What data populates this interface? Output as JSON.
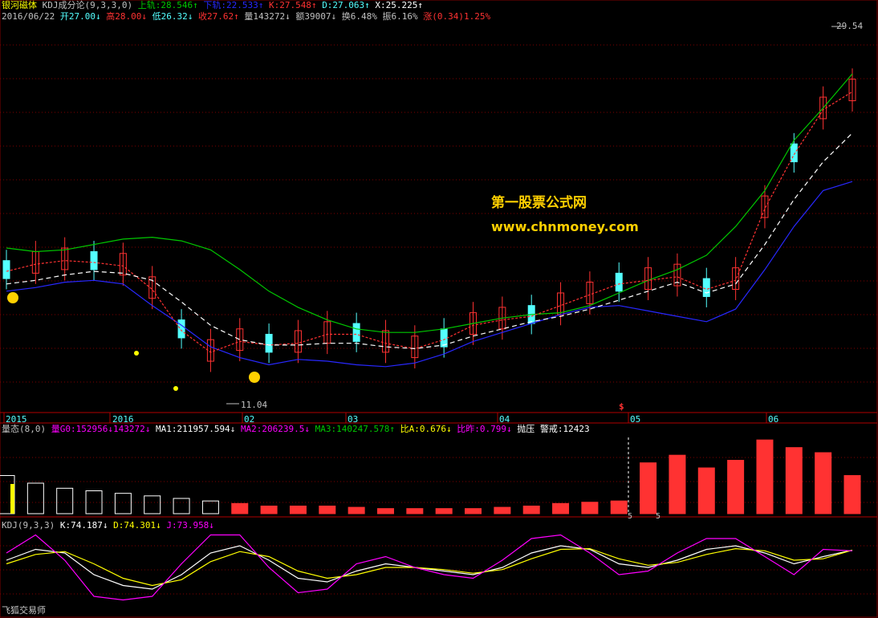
{
  "header1": {
    "indicator": "银河磁体",
    "indicator_params": "KDJ成分论(9,3,3,0)",
    "up_label": "上轨:28.546↑",
    "down_label": "下轨:22.533↑",
    "k_label": "K:27.548↑",
    "d_label": "D:27.063↑",
    "x_label": "X:25.225↑"
  },
  "header2": {
    "date": "2016/06/22",
    "open": "开27.00↓",
    "high": "高28.00↓",
    "low": "低26.32↓",
    "close": "收27.62↑",
    "volume": "量143272↓",
    "amount": "额39007↓",
    "turnover": "换6.48%",
    "amplitude": "振6.16%",
    "change": "涨(0.34)1.25%"
  },
  "vol_header": {
    "title": "量态(8,0)",
    "vol": "量G0:152956↓143272↓",
    "ma1": "MA1:211957.594↓",
    "ma2": "MA2:206239.5↓",
    "ma3": "MA3:140247.578↑",
    "ratio_a": "比A:0.676↓",
    "ratio_b": "比昨:0.799↓",
    "pressure": "抛压 警戒:12423"
  },
  "kdj_header": {
    "title": "KDJ(9,3,3)",
    "k": "K:74.187↓",
    "d": "D:74.301↓",
    "j": "J:73.958↓"
  },
  "x_axis_labels": [
    "2015",
    "2016",
    "02",
    "03",
    "04",
    "05",
    "06"
  ],
  "price_labels": {
    "high": "29.54",
    "low": "11.04"
  },
  "marker_dollar": "$",
  "volume_bottom_labels": [
    "5",
    "5"
  ],
  "watermark": {
    "line1": "第一股票公式网",
    "line2": "www.chnmoney.com"
  },
  "footer": "飞狐交易师",
  "colors": {
    "up": "#ff3232",
    "down": "#54ffff",
    "mid": "#00c800",
    "lower": "#2828ff",
    "ma": "#c832c8",
    "signal": "#ffffff",
    "yellow": "#ffff00",
    "magenta": "#ff00ff"
  },
  "chart_data": [
    {
      "type": "candlestick",
      "title": "",
      "x_ticks": [
        "2015",
        "2016",
        "02",
        "03",
        "04",
        "05",
        "06"
      ],
      "y_range": [
        10,
        31
      ],
      "annotations": [
        "29.54",
        "11.04"
      ],
      "series": [
        {
          "name": "上轨",
          "color": "#00c800",
          "values": [
            18.8,
            18.6,
            18.7,
            19.0,
            19.3,
            19.4,
            19.2,
            18.7,
            17.6,
            16.4,
            15.5,
            14.8,
            14.3,
            14.1,
            14.1,
            14.3,
            14.6,
            14.9,
            15.1,
            15.2,
            15.6,
            16.3,
            17.0,
            17.6,
            18.4,
            20.0,
            22.0,
            24.8,
            26.6,
            28.5
          ]
        },
        {
          "name": "下轨",
          "color": "#2828ff",
          "values": [
            16.4,
            16.6,
            16.9,
            17.0,
            16.8,
            15.6,
            14.5,
            13.3,
            12.7,
            12.3,
            12.6,
            12.5,
            12.3,
            12.2,
            12.4,
            12.9,
            13.6,
            14.1,
            14.6,
            15.1,
            15.5,
            15.6,
            15.3,
            15.0,
            14.7,
            15.4,
            17.6,
            20.0,
            22.0,
            22.5
          ]
        },
        {
          "name": "K",
          "color": "#ff3232",
          "values": [
            17.5,
            17.9,
            18.1,
            18.0,
            17.8,
            16.5,
            14.2,
            13.0,
            13.6,
            13.4,
            13.5,
            14.0,
            14.0,
            13.5,
            13.2,
            13.7,
            14.5,
            14.8,
            15.0,
            15.6,
            16.2,
            16.8,
            17.0,
            17.2,
            16.5,
            17.0,
            21.0,
            24.0,
            26.5,
            27.5
          ]
        },
        {
          "name": "X",
          "color": "#ffffff",
          "values": [
            16.8,
            17.0,
            17.3,
            17.5,
            17.4,
            17.0,
            15.8,
            14.5,
            13.7,
            13.4,
            13.4,
            13.5,
            13.5,
            13.3,
            13.2,
            13.4,
            13.9,
            14.3,
            14.7,
            15.0,
            15.4,
            15.9,
            16.4,
            16.9,
            16.3,
            16.8,
            19.0,
            21.5,
            23.6,
            25.2
          ]
        }
      ]
    },
    {
      "type": "bar",
      "title": "量态(8,0)",
      "series": [
        {
          "name": "量",
          "color": "#ff3232",
          "values": [
            150000,
            120000,
            100000,
            90000,
            80000,
            70000,
            60000,
            50000,
            40000,
            30000,
            30000,
            30000,
            25000,
            20000,
            20000,
            20000,
            20000,
            25000,
            30000,
            40000,
            45000,
            50000,
            200000,
            230000,
            180000,
            210000,
            290000,
            260000,
            240000,
            150000
          ]
        }
      ]
    },
    {
      "type": "line",
      "title": "KDJ(9,3,3)",
      "y_range": [
        0,
        100
      ],
      "series": [
        {
          "name": "K",
          "color": "#ffffff",
          "values": [
            60,
            75,
            70,
            40,
            25,
            20,
            40,
            70,
            80,
            60,
            35,
            30,
            45,
            55,
            50,
            45,
            40,
            50,
            70,
            80,
            75,
            55,
            50,
            60,
            75,
            80,
            70,
            55,
            65,
            74
          ]
        },
        {
          "name": "D",
          "color": "#ffff00",
          "values": [
            55,
            68,
            72,
            55,
            35,
            25,
            33,
            58,
            72,
            65,
            45,
            35,
            40,
            50,
            50,
            47,
            42,
            47,
            62,
            75,
            76,
            62,
            53,
            57,
            68,
            76,
            73,
            60,
            62,
            74
          ]
        },
        {
          "name": "J",
          "color": "#ff00ff",
          "values": [
            70,
            95,
            60,
            10,
            5,
            10,
            55,
            95,
            95,
            50,
            15,
            20,
            55,
            65,
            50,
            40,
            35,
            60,
            90,
            95,
            70,
            40,
            45,
            70,
            90,
            90,
            65,
            40,
            75,
            73
          ]
        }
      ]
    }
  ]
}
